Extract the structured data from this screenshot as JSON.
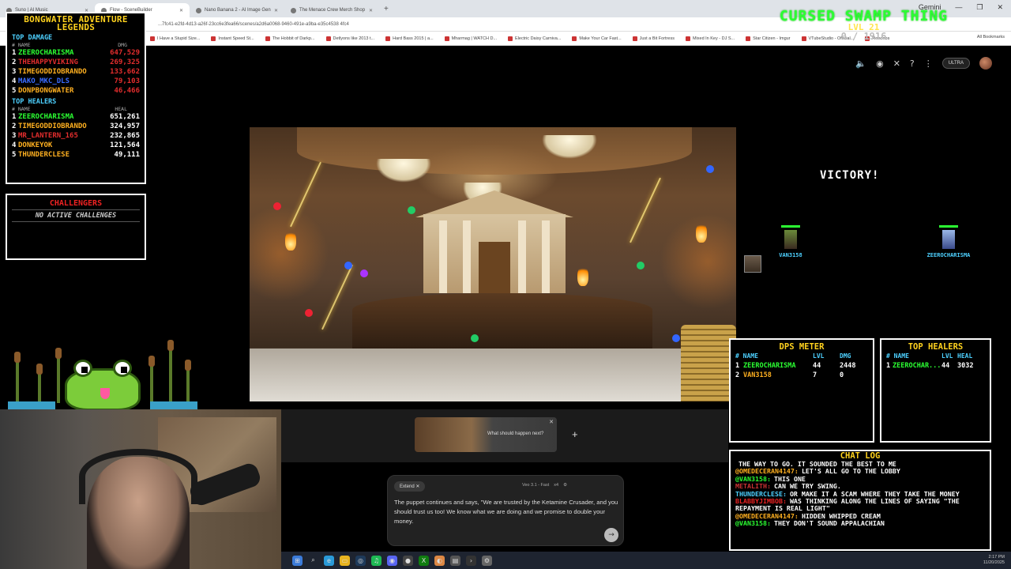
{
  "browser": {
    "tabs": [
      {
        "label": "Suno | AI Music"
      },
      {
        "label": "Flow - SceneBuilder"
      },
      {
        "label": "Nano Banana 2 - AI Image Gen"
      },
      {
        "label": "The Menace Crew Merch Shop"
      }
    ],
    "new_tab": "+",
    "gemini": "Gemini",
    "window_controls": [
      "—",
      "❐",
      "✕"
    ],
    "address": "...7fc41-e2fd-4d13-a26f-23cc6e3fea66/scenes/a2d6a0068-9460-491e-a9ba-e35c4538 4fc4",
    "bookmarks": [
      "I Have a Stupid Size...",
      "Instant Speed St...",
      "The Hobbit of Darkp...",
      "Detlyons like 2013 t...",
      "Hard Bass 2015 | a...",
      "Mharmag | WATCH D...",
      "Electric Daisy Carniva...",
      "Make Your Car Fast...",
      "Just a Bit Fortress",
      "Mixed In Key - DJ S...",
      "Star Citizen - Imgur",
      "VTubeStudio - Official...",
      "Roooobs"
    ],
    "all_bookmarks": "All Bookmarks"
  },
  "page": {
    "icons": [
      "speaker-icon",
      "discord-icon",
      "x-icon",
      "help-icon",
      "more-icon"
    ],
    "ultra_badge": "ULTRA"
  },
  "prompt_area": {
    "thumbnail_question": "What should happen next?",
    "thumbnail_close": "✕",
    "add": "+",
    "extend_chip": "Extend",
    "model": "Veo 3.1 - Fast",
    "count": "x4",
    "text": "The puppet continues and says, \"We are trusted by the Ketamine Crusader, and you should trust us too! We know what we are doing and we promise to double your money.",
    "send": "→"
  },
  "overlay": {
    "legends": {
      "title": "BONGWATER ADVENTURE LEGENDS",
      "damage_title": "TOP DAMAGE",
      "damage_header": [
        "# NAME",
        "DMG"
      ],
      "damage_rows": [
        {
          "rank": "1",
          "name": "ZEEROCHARISMA",
          "value": "647,529",
          "color": "#2bff32"
        },
        {
          "rank": "2",
          "name": "THEHAPPYVIKING",
          "value": "269,325",
          "color": "#e22d2d"
        },
        {
          "rank": "3",
          "name": "TIMEGODDIOBRANDO",
          "value": "133,662",
          "color": "#ffb020"
        },
        {
          "rank": "4",
          "name": "MAKO_MKC_DLS",
          "value": "79,103",
          "color": "#3a6cff"
        },
        {
          "rank": "5",
          "name": "DONPBONGWATER",
          "value": "46,466",
          "color": "#ffb020"
        }
      ],
      "heal_title": "TOP HEALERS",
      "heal_header": [
        "# NAME",
        "HEAL"
      ],
      "heal_rows": [
        {
          "rank": "1",
          "name": "ZEEROCHARISMA",
          "value": "651,261",
          "color": "#2bff32"
        },
        {
          "rank": "2",
          "name": "TIMEGODDIOBRANDO",
          "value": "324,957",
          "color": "#ffb020"
        },
        {
          "rank": "3",
          "name": "MR_LANTERN_165",
          "value": "232,865",
          "color": "#e22d2d"
        },
        {
          "rank": "4",
          "name": "DONKEYOK",
          "value": "121,564",
          "color": "#ffb020"
        },
        {
          "rank": "5",
          "name": "THUNDERCLESE",
          "value": "49,111",
          "color": "#ffb020"
        }
      ]
    },
    "challenges": {
      "title": "CHALLENGERS",
      "status": "NO ACTIVE CHALLENGES"
    },
    "swamp": {
      "title": "CURSED SWAMP THING",
      "level": "LVL 21",
      "xp": "0 / 1916"
    },
    "victory": "VICTORY!",
    "characters": [
      {
        "name": "VAN3158",
        "color": "#4dd0ff"
      },
      {
        "name": "ZEEROCHARISMA",
        "color": "#4dd0ff"
      }
    ],
    "dps": {
      "title": "DPS METER",
      "header": [
        "# NAME",
        "LVL",
        "DMG"
      ],
      "rows": [
        {
          "rank": "1",
          "name": "ZEEROCHARISMA",
          "lvl": "44",
          "dmg": "2448",
          "color": "#2bff32"
        },
        {
          "rank": "2",
          "name": "VAN3158",
          "lvl": "7",
          "dmg": "0",
          "color": "#ffb020"
        }
      ]
    },
    "healers_small": {
      "title": "TOP HEALERS",
      "header": [
        "# NAME",
        "LVL",
        "HEAL"
      ],
      "rows": [
        {
          "rank": "1",
          "name": "ZEEROCHAR...",
          "lvl": "44",
          "heal": "3032",
          "color": "#2bff32"
        }
      ]
    },
    "chat": {
      "title": "CHAT LOG",
      "messages": [
        {
          "user": "",
          "text": "THE WAY TO GO. IT SOUNDED THE BEST TO ME",
          "color": "#ffb020"
        },
        {
          "user": "@OMEDECERAN4147:",
          "text": "LET'S ALL GO TO THE LOBBY",
          "color": "#ffb020"
        },
        {
          "user": "@VAN3158:",
          "text": "THIS ONE",
          "color": "#2bff32"
        },
        {
          "user": "METALITH:",
          "text": "CAN WE TRY SWING.",
          "color": "#c33"
        },
        {
          "user": "THUNDERCLESE:",
          "text": "OR MAKE IT A SCAM WHERE THEY TAKE THE MONEY",
          "color": "#4dd0ff"
        },
        {
          "user": "BLABBYJIMBOB:",
          "text": "WAS THINKING ALONG THE LINES OF SAYING \"THE REPAYMENT IS REAL LIGHT\"",
          "color": "#e22"
        },
        {
          "user": "@OMEDECERAN4147:",
          "text": "HIDDEN WHIPPED CREAM",
          "color": "#ffb020"
        },
        {
          "user": "@VAN3158:",
          "text": "THEY DON'T SOUND APPALACHIAN",
          "color": "#2bff32"
        }
      ]
    }
  },
  "taskbar": {
    "icons": [
      "start-icon",
      "search-icon",
      "edge-icon",
      "chrome-icon",
      "folder-icon",
      "steam-icon",
      "spotify-icon",
      "discord-icon",
      "obs-icon",
      "xbox-icon",
      "store-icon",
      "terminal-icon",
      "settings-icon"
    ],
    "time": "2:17 PM",
    "date": "11/20/2025"
  },
  "colors": {
    "accent_yellow": "#ffd21e",
    "accent_cyan": "#4dd0ff",
    "accent_green": "#2bff32"
  }
}
